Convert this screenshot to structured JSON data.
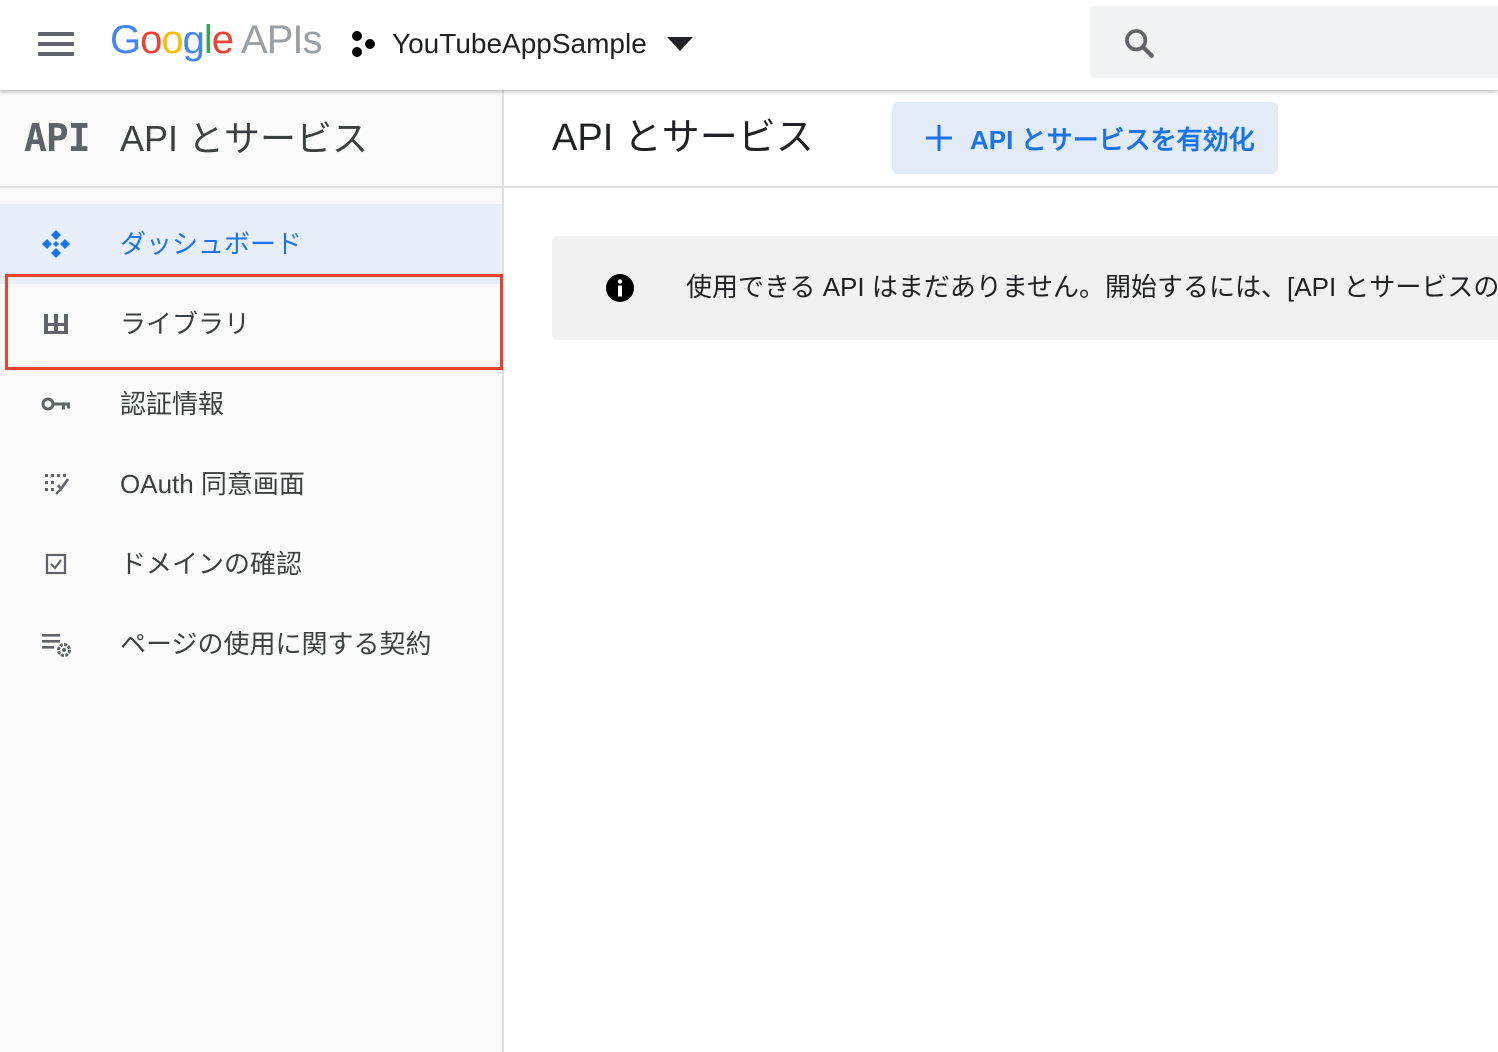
{
  "header": {
    "logo_google": "Google",
    "logo_apis": "APIs",
    "project_name": "YouTubeAppSample",
    "search_placeholder": ""
  },
  "sidebar": {
    "badge": "API",
    "title": "API とサービス",
    "items": [
      {
        "label": "ダッシュボード",
        "icon": "dashboard-icon",
        "active": true
      },
      {
        "label": "ライブラリ",
        "icon": "library-icon",
        "active": false
      },
      {
        "label": "認証情報",
        "icon": "key-icon",
        "active": false
      },
      {
        "label": "OAuth 同意画面",
        "icon": "oauth-consent-icon",
        "active": false
      },
      {
        "label": "ドメインの確認",
        "icon": "checkbox-icon",
        "active": false
      },
      {
        "label": "ページの使用に関する契約",
        "icon": "settings-list-icon",
        "active": false
      }
    ]
  },
  "main": {
    "title": "API とサービス",
    "enable_button_label": "API とサービスを有効化",
    "notice_text": "使用できる API はまだありません。開始するには、[API とサービスの有効化]"
  },
  "colors": {
    "accent": "#1a73e8",
    "active_bg": "#e8eef9",
    "button_bg": "#e3ebf9",
    "highlight": "#e84231",
    "notice_bg": "#f1f1f1"
  }
}
